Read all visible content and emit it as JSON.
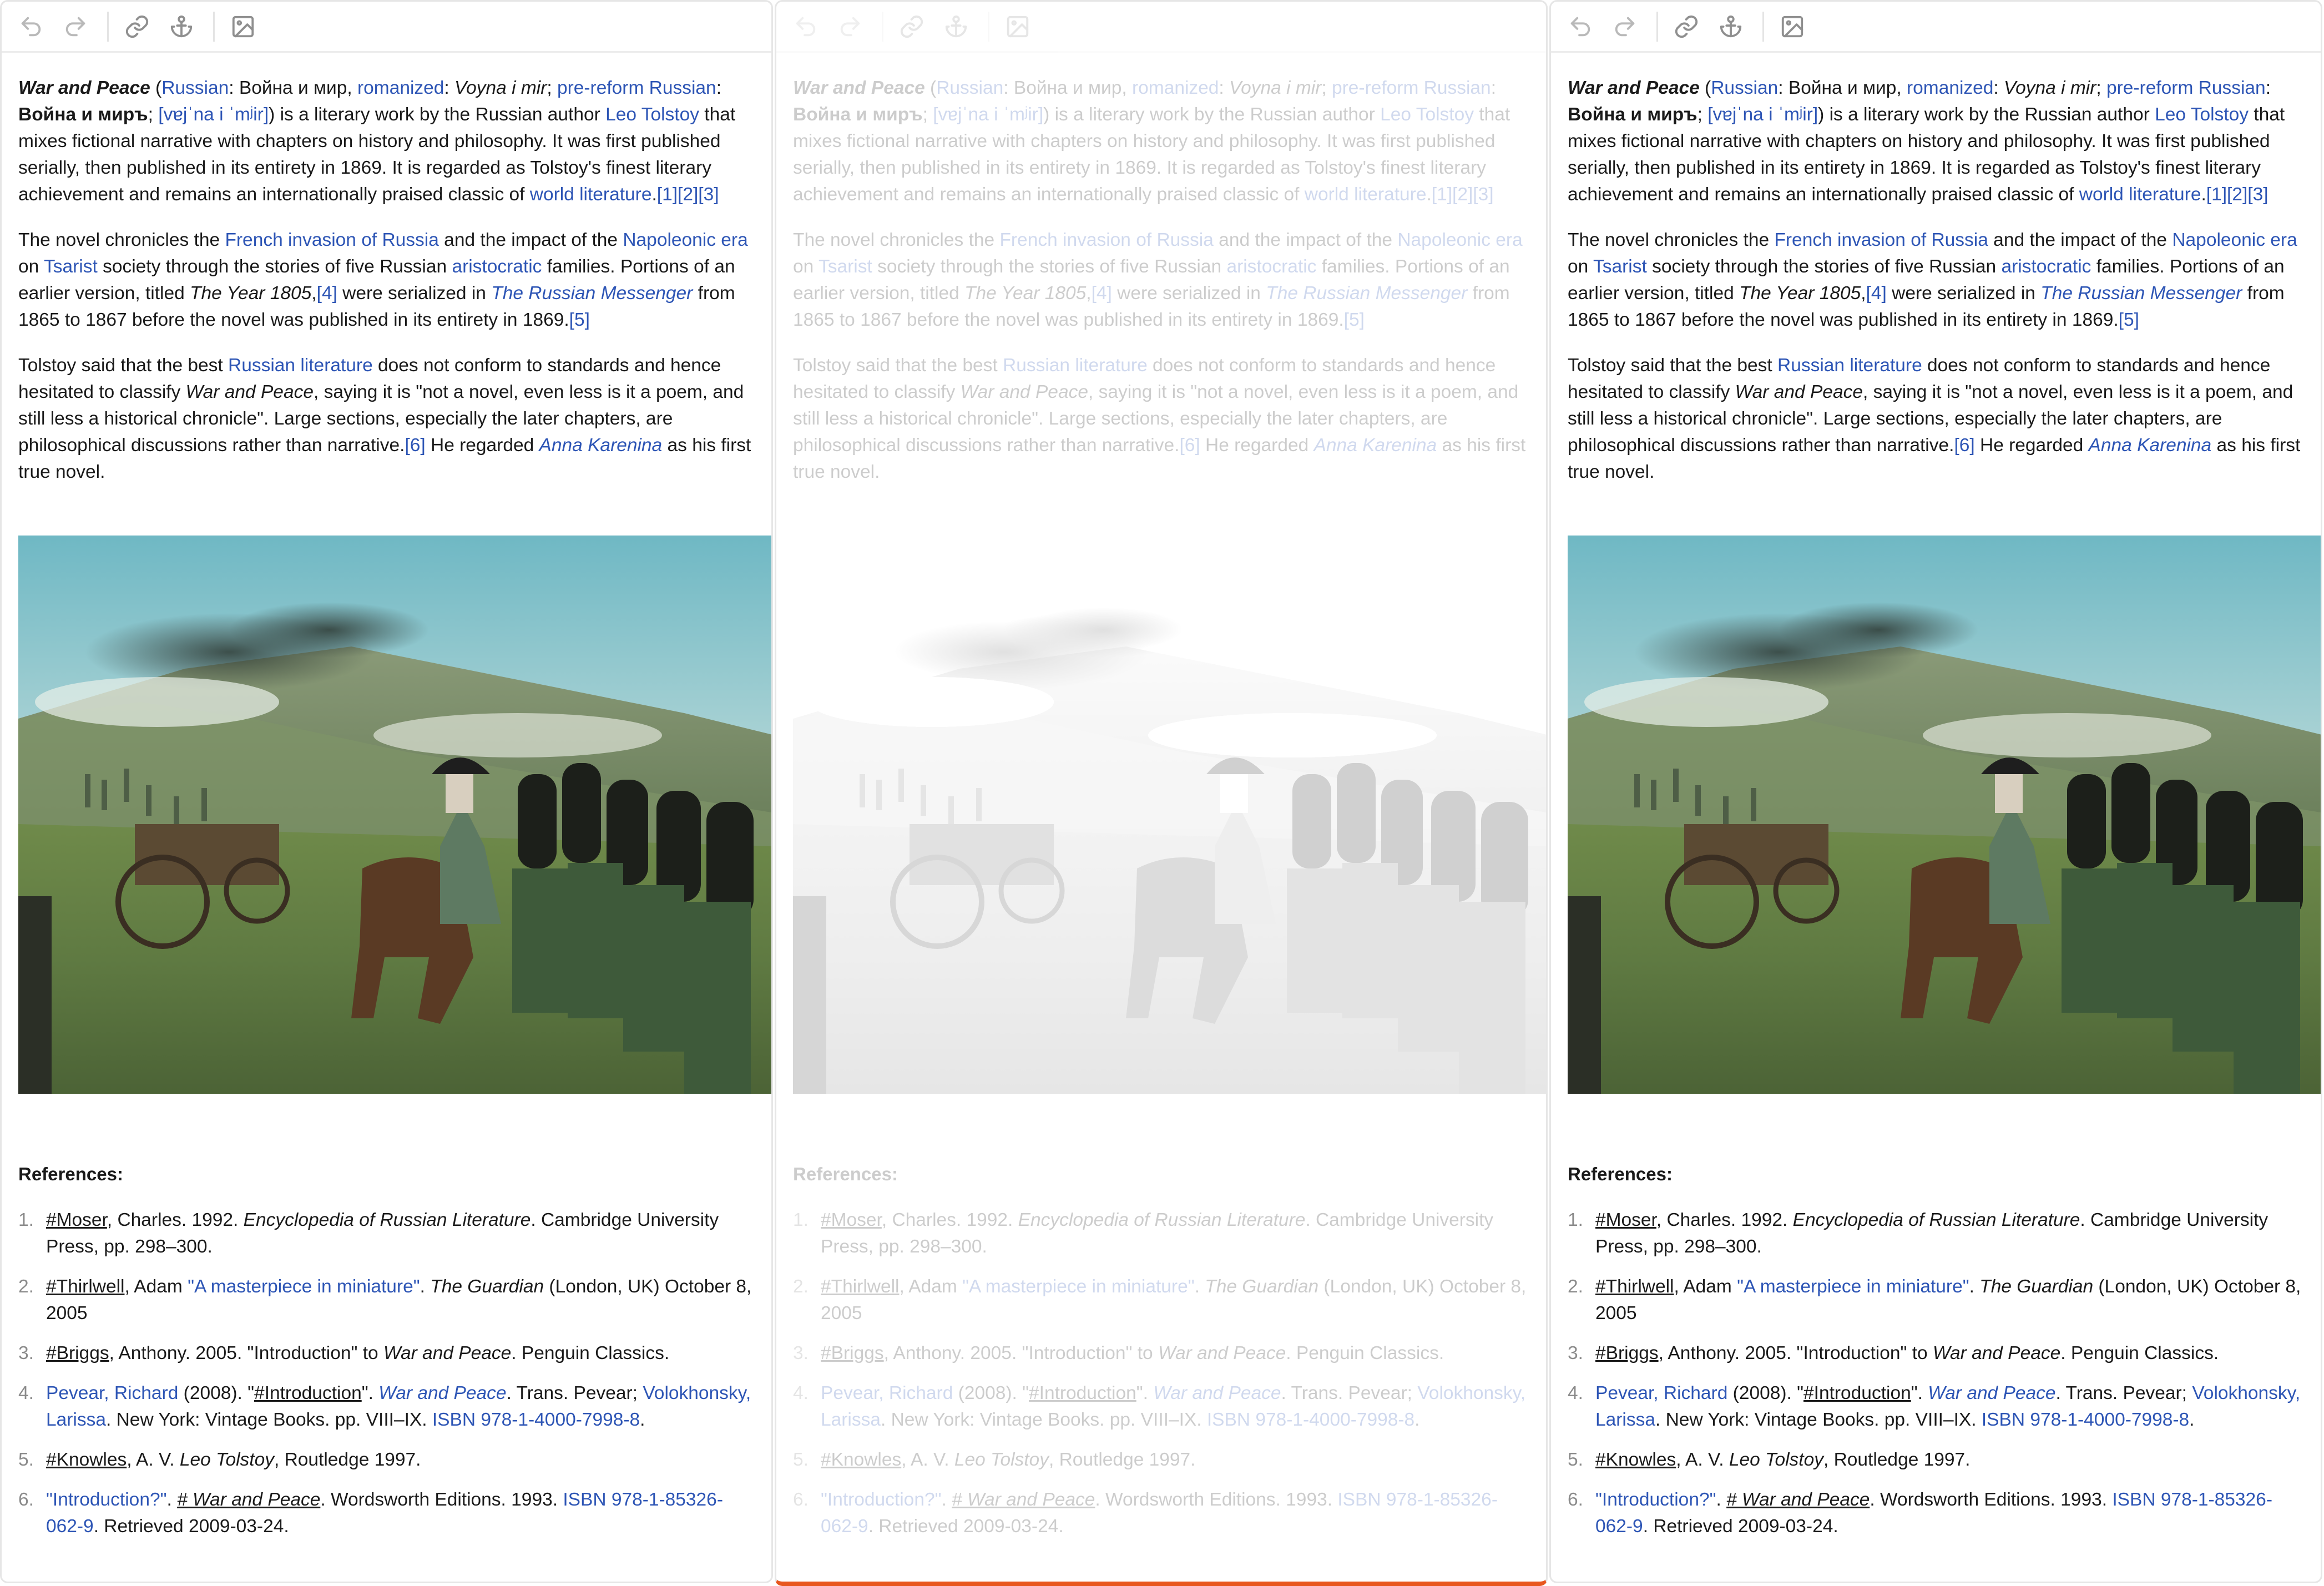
{
  "toolbar": {
    "icons": [
      "undo-icon",
      "redo-icon",
      "link-icon",
      "anchor-icon",
      "image-icon"
    ]
  },
  "article": {
    "p1": {
      "title": "War and Peace",
      "open_paren": " (",
      "russian_link": "Russian",
      "russian_text": ": Война и мир, ",
      "romanized_link": "romanized",
      "colon1": ": ",
      "romanized_text": "Voyna i mir",
      "semi1": "; ",
      "prereform_link": "pre-reform Russian",
      "colon2": ": ",
      "prereform_text": "Война и миръ",
      "semi2": "; ",
      "ipa_link": "[vɐjˈna i ˈmʲir]",
      "text1": ") is a literary work by the Russian author ",
      "tolstoy_link": "Leo Tolstoy",
      "text2": " that mixes fictional narrative with chapters on history and philosophy. It was first published serially, then published in its entirety in 1869. It is regarded as Tolstoy's finest literary achievement and remains an internationally praised classic of ",
      "worldlit_link": "world literature",
      "text3": ".",
      "cite": "[1][2][3]"
    },
    "p2": {
      "t1": "The novel chronicles the ",
      "french_link": "French invasion of Russia",
      "t2": " and the impact of the ",
      "napoleonic_link": "Napoleonic era",
      "t3": " on ",
      "tsarist_link": "Tsarist",
      "t4": " society through the stories of five Russian ",
      "aristocratic_link": "aristocratic",
      "t5": " families. Portions of an earlier version, titled ",
      "year_text": "The Year 1805",
      "t6": ",",
      "cite4": "[4]",
      "t7": " were serialized in ",
      "messenger_link": "The Russian Messenger",
      "t8": " from 1865 to 1867 before the novel was published in its entirety in 1869.",
      "cite5": "[5]"
    },
    "p3": {
      "t1": "Tolstoy said that the best ",
      "ruslit_link": "Russian literature",
      "t2": " does not conform to standards and hence hesitated to classify ",
      "wp_text": "War and Peace",
      "t3": ", saying it is \"not a novel, even less is it a poem, and still less a historical chronicle\". Large sections, especially the later chapters, are philosophical discussions rather than narrative.",
      "cite6": "[6]",
      "t4": " He regarded ",
      "anna_link": "Anna Karenina",
      "t5": " as his first true novel."
    }
  },
  "references": {
    "title": "References",
    "colon": ":",
    "items": [
      {
        "num": "1.",
        "anchor": "#Moser",
        "t1": ", Charles. 1992. ",
        "italic": "Encyclopedia of Russian Literature",
        "t2": ". Cambridge University Press, pp. 298–300."
      },
      {
        "num": "2.",
        "anchor": "#Thirlwell",
        "t1": ", Adam ",
        "link": "\"A masterpiece in miniature\"",
        "t2": ". ",
        "italic": "The Guardian",
        "t3": " (London, UK) October 8, 2005"
      },
      {
        "num": "3.",
        "anchor": "#Briggs",
        "t1": ", Anthony. 2005. \"Introduction\" to ",
        "italic": "War and Peace",
        "t2": ". Penguin Classics."
      },
      {
        "num": "4.",
        "link1": "Pevear, Richard",
        "t1": " (2008). \"",
        "anchor": "#Introduction",
        "t2": "\". ",
        "italic_link": "War and Peace",
        "t3": ". Trans. Pevear; ",
        "link2": "Volokhonsky, Larissa",
        "t4": ". New York: Vintage Books. pp. VIII–IX. ",
        "isbn": "ISBN 978-1-4000-7998-8",
        "t5": "."
      },
      {
        "num": "5.",
        "anchor": "#Knowles",
        "t1": ", A. V. ",
        "italic": "Leo Tolstoy",
        "t2": ", Routledge 1997."
      },
      {
        "num": "6.",
        "link": "\"Introduction?\"",
        "t1": ". ",
        "anchor": "# War and Peace",
        "t2": ". Wordsworth Editions. 1993. ",
        "isbn": "ISBN 978-1-85326-062-9",
        "t3": ". Retrieved 2009-03-24."
      }
    ]
  },
  "colors": {
    "link": "#2d55b5",
    "accent_bar": "#e8571e",
    "border": "#e6e6e6"
  }
}
